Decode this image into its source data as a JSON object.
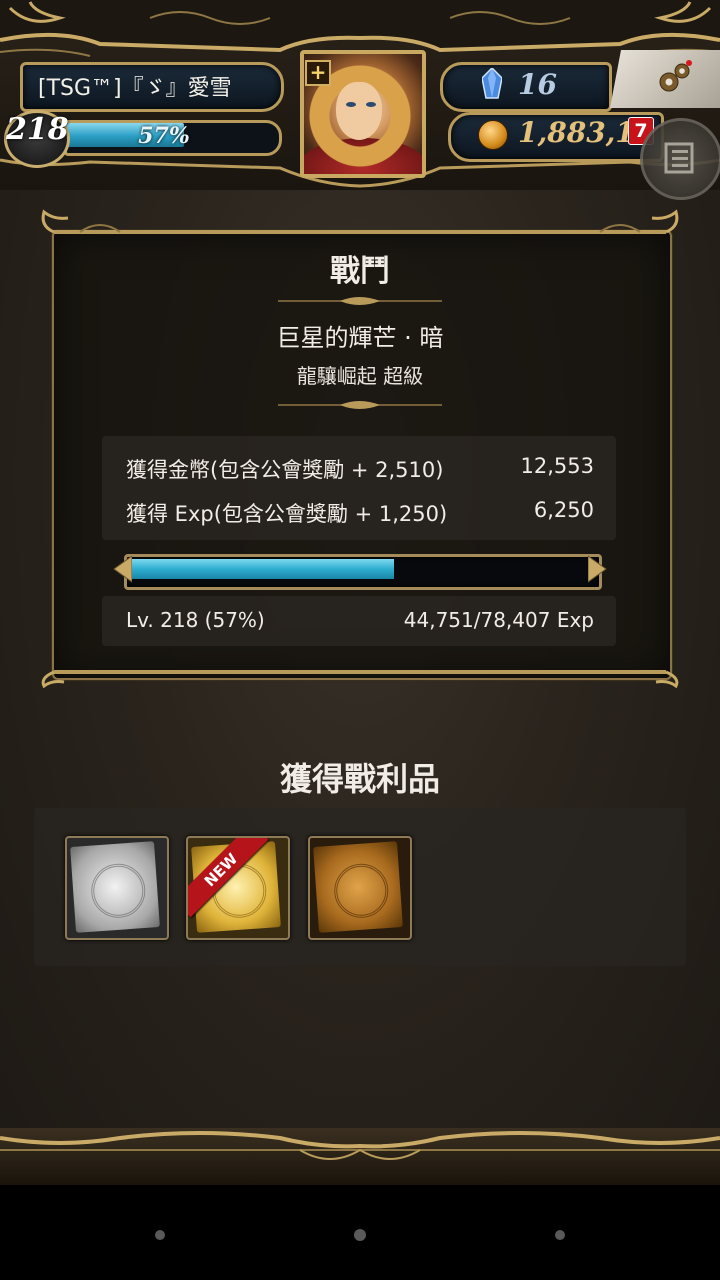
{
  "hud": {
    "player_name": "[TSG™]『ゞ』愛雪",
    "level": "218",
    "exp_percent_label": "57%",
    "exp_fraction": 0.57,
    "gems": "16",
    "coins": "1,883,11",
    "notification_count": "7"
  },
  "battle": {
    "title": "戰鬥",
    "quest_name": "巨星的輝芒 · 暗",
    "quest_difficulty": "龍驤崛起 超級",
    "rewards": [
      {
        "label": "獲得金幣(包含公會獎勵 + 2,510)",
        "value": "12,553"
      },
      {
        "label": "獲得 Exp(包含公會獎勵 + 1,250)",
        "value": "6,250"
      }
    ],
    "exp_fraction": 0.57,
    "level_label": "Lv. 218 (57%)",
    "exp_label": "44,751/78,407 Exp"
  },
  "loot": {
    "title": "獲得戰利品",
    "items": [
      {
        "kind": "silver-card",
        "badge": ""
      },
      {
        "kind": "gold-card",
        "badge": "NEW"
      },
      {
        "kind": "bronze-card",
        "badge": ""
      }
    ]
  },
  "colors": {
    "exp_bar": "#2eaed0",
    "frame_gold": "#b89a5a",
    "new_ribbon": "#b5141a"
  }
}
